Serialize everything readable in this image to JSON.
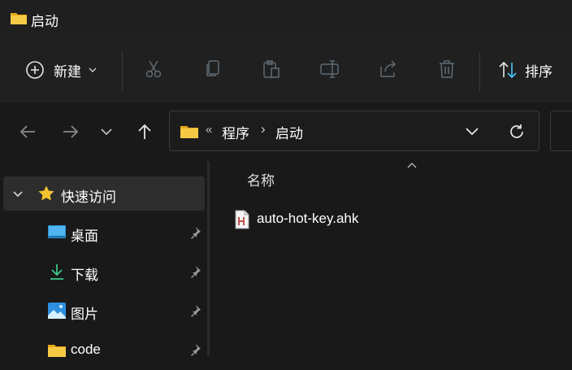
{
  "window": {
    "title": "启动"
  },
  "toolbar": {
    "new_label": "新建",
    "sort_label": "排序"
  },
  "address": {
    "chevrons": "«",
    "crumbs": [
      "程序",
      "启动"
    ],
    "separator": "›"
  },
  "nav_pane": {
    "quick_access_label": "快速访问",
    "items": [
      {
        "label": "桌面",
        "icon": "desktop-icon"
      },
      {
        "label": "下载",
        "icon": "download-icon"
      },
      {
        "label": "图片",
        "icon": "pictures-icon"
      },
      {
        "label": "code",
        "icon": "folder-icon"
      }
    ]
  },
  "content": {
    "column_name": "名称",
    "files": [
      {
        "name": "auto-hot-key.ahk",
        "icon": "ahk-file-icon"
      }
    ]
  },
  "colors": {
    "folder": "#f0c14b",
    "accent": "#4cc2ff",
    "star": "#f4c430"
  }
}
